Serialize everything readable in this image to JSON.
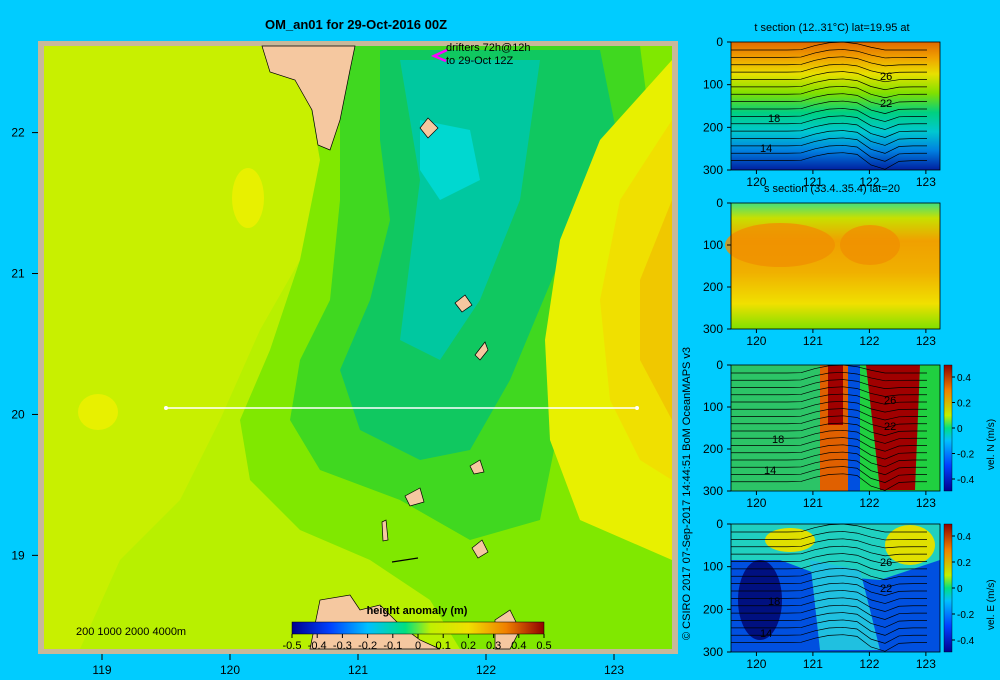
{
  "main": {
    "title": "OM_an01 for 29-Oct-2016 00Z",
    "drifters_line1": "drifters 72h@12h",
    "drifters_line2": "to 29-Oct 12Z",
    "depth_legend": "200  1000  2000  4000m",
    "colorbar_label": "height anomaly  (m)",
    "colorbar_ticks": [
      "-0.5",
      "-0.4",
      "-0.3",
      "-0.2",
      "-0.1",
      "0",
      "0.1",
      "0.2",
      "0.3",
      "0.4",
      "0.5"
    ]
  },
  "credit": "© CSIRO 2017   07-Sep-2017 14:44:51 BoM OceanMAPS v3",
  "panels": [
    {
      "id": "t",
      "title": "t section (12..31°C) lat=19.95 at",
      "labels": [
        "26",
        "22",
        "18",
        "14"
      ]
    },
    {
      "id": "s",
      "title": "s section (33.4..35.4) lat=20",
      "labels": []
    },
    {
      "id": "vn",
      "title": "",
      "cb_label": "vel. N  (m/s)",
      "cb_ticks": [
        "0.4",
        "0.2",
        "0",
        "-0.2",
        "-0.4"
      ],
      "labels": [
        "26",
        "22",
        "18",
        "14"
      ]
    },
    {
      "id": "ve",
      "title": "",
      "cb_label": "vel. E  (m/s)",
      "cb_ticks": [
        "0.4",
        "0.2",
        "0",
        "-0.2",
        "-0.4"
      ],
      "labels": [
        "26",
        "22",
        "18",
        "14"
      ]
    }
  ],
  "colors": {
    "background": "#00ccff",
    "land": "#f5c8a0",
    "shelf": "#c8b89a"
  },
  "chart_data": [
    {
      "type": "heatmap",
      "title": "OM_an01 for 29-Oct-2016 00Z",
      "x_ticks": [
        119,
        120,
        121,
        122,
        123
      ],
      "y_ticks": [
        22,
        21,
        20,
        19
      ],
      "xlim": [
        118.5,
        123.5
      ],
      "ylim": [
        18.3,
        22.65
      ],
      "colorbar": {
        "label": "height anomaly  (m)",
        "range": [
          -0.5,
          0.5
        ]
      },
      "section_line": {
        "lat": 20,
        "lon": [
          119.5,
          123.2
        ]
      }
    },
    {
      "type": "heatmap",
      "title": "t section (12..31°C) lat=19.95 at",
      "x_ticks": [
        120,
        121,
        122,
        123
      ],
      "y_ticks": [
        0,
        100,
        200,
        300
      ],
      "ylim": [
        0,
        300
      ],
      "contours": [
        26,
        22,
        18,
        14
      ]
    },
    {
      "type": "heatmap",
      "title": "s section (33.4..35.4) lat=20",
      "x_ticks": [
        120,
        121,
        122,
        123
      ],
      "y_ticks": [
        0,
        100,
        200,
        300
      ],
      "ylim": [
        0,
        300
      ]
    },
    {
      "type": "heatmap",
      "title": "",
      "x_ticks": [
        120,
        121,
        122,
        123
      ],
      "y_ticks": [
        0,
        100,
        200,
        300
      ],
      "ylim": [
        0,
        300
      ],
      "colorbar": {
        "label": "vel. N  (m/s)",
        "range": [
          -0.4,
          0.4
        ]
      }
    },
    {
      "type": "heatmap",
      "title": "",
      "x_ticks": [
        120,
        121,
        122,
        123
      ],
      "y_ticks": [
        0,
        100,
        200,
        300
      ],
      "ylim": [
        0,
        300
      ],
      "colorbar": {
        "label": "vel. E  (m/s)",
        "range": [
          -0.4,
          0.4
        ]
      }
    }
  ]
}
